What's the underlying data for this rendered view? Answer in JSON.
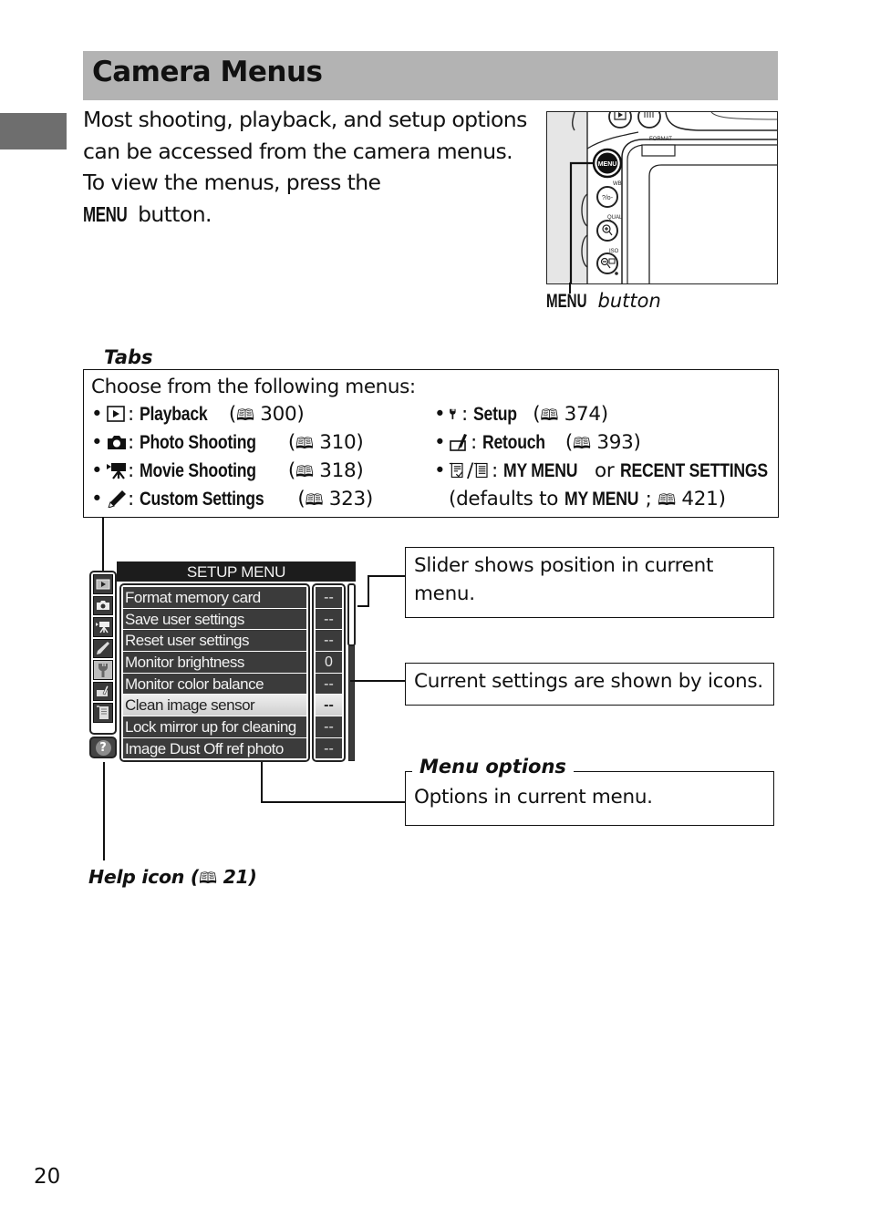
{
  "page": {
    "title": "Camera Menus",
    "page_number": "20"
  },
  "intro": {
    "text_before": "Most shooting, playback, and setup options can be accessed from the camera menus.  To view the menus, press the ",
    "menu_glyph": "MENU",
    "text_after": " button."
  },
  "camera_figure": {
    "caption_glyph": "MENU",
    "caption_text": " button",
    "labels": {
      "menu": "MENU",
      "wb": "WB",
      "qual": "QUAL",
      "iso": "ISO",
      "format": "FORMAT"
    }
  },
  "tabs": {
    "heading": "Tabs",
    "intro": "Choose from the following menus:",
    "book_glyph": "⬚",
    "items": [
      {
        "icon": "playback-icon",
        "name": "Playback",
        "ref": "300"
      },
      {
        "icon": "camera-icon",
        "name": "Photo Shooting",
        "ref": "310"
      },
      {
        "icon": "movie-camera-icon",
        "name": "Movie Shooting",
        "ref": "318"
      },
      {
        "icon": "pencil-icon",
        "name": "Custom Settings",
        "ref": "323"
      },
      {
        "icon": "wrench-icon",
        "name": "Setup",
        "ref": "374"
      },
      {
        "icon": "retouch-icon",
        "name": "Retouch",
        "ref": "393"
      }
    ],
    "my_menu": {
      "name1": "MY MENU",
      "or": " or ",
      "name2": "RECENT SETTINGS",
      "defaults_prefix": "(defaults to ",
      "defaults_name": "MY MENU",
      "ref": "421",
      "suffix": ")"
    }
  },
  "menu_screen": {
    "title": "SETUP MENU",
    "tab_icons": [
      "playback-icon",
      "camera-icon",
      "movie-camera-icon",
      "pencil-icon",
      "wrench-icon",
      "retouch-icon",
      "my-menu-icon"
    ],
    "active_tab": "wrench-icon",
    "help_glyph": "?",
    "options": [
      {
        "label": "Format memory card",
        "value": "--"
      },
      {
        "label": "Save user settings",
        "value": "--"
      },
      {
        "label": "Reset user settings",
        "value": "--"
      },
      {
        "label": "Monitor brightness",
        "value": "0"
      },
      {
        "label": "Monitor color balance",
        "value": "--"
      },
      {
        "label": "Clean image sensor",
        "value": "--",
        "selected": true
      },
      {
        "label": "Lock mirror up for cleaning",
        "value": "--"
      },
      {
        "label": "Image Dust Off ref photo",
        "value": "--"
      }
    ],
    "slider_position_fraction": 0.0,
    "slider_visible_fraction": 0.35
  },
  "callouts": {
    "slider": "Slider shows position in current menu.",
    "settings": "Current settings are shown by icons.",
    "menu_options_heading": "Menu options",
    "menu_options": "Options in current menu.",
    "help_label": "Help icon (",
    "help_ref": "21)"
  }
}
